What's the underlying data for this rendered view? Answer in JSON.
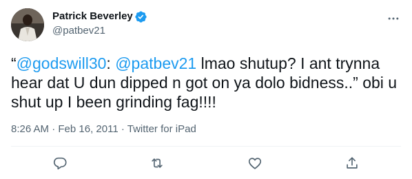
{
  "author": {
    "display_name": "Patrick Beverley",
    "handle": "@patbev21",
    "verified": true,
    "avatar_icon": "user-avatar",
    "verified_icon": "verified-badge-icon"
  },
  "tweet": {
    "parts": {
      "open_quote": "“",
      "mention1": "@godswill30",
      "colon": ": ",
      "mention2": "@patbev21",
      "text": " lmao shutup? I ant trynna hear dat U dun dipped n got on ya dolo bidness..” obi u shut up I been grinding fag!!!!"
    },
    "time": "8:26 AM",
    "separator1": " · ",
    "date": "Feb 16, 2011",
    "separator2": " · ",
    "source": "Twitter for iPad"
  },
  "actions": [
    {
      "name": "reply",
      "icon": "reply-icon"
    },
    {
      "name": "retweet",
      "icon": "retweet-icon"
    },
    {
      "name": "like",
      "icon": "like-icon"
    },
    {
      "name": "share",
      "icon": "share-icon"
    }
  ],
  "colors": {
    "text": "#0f1419",
    "secondary": "#536471",
    "accent": "#1d9bf0",
    "divider": "#eff3f4"
  }
}
